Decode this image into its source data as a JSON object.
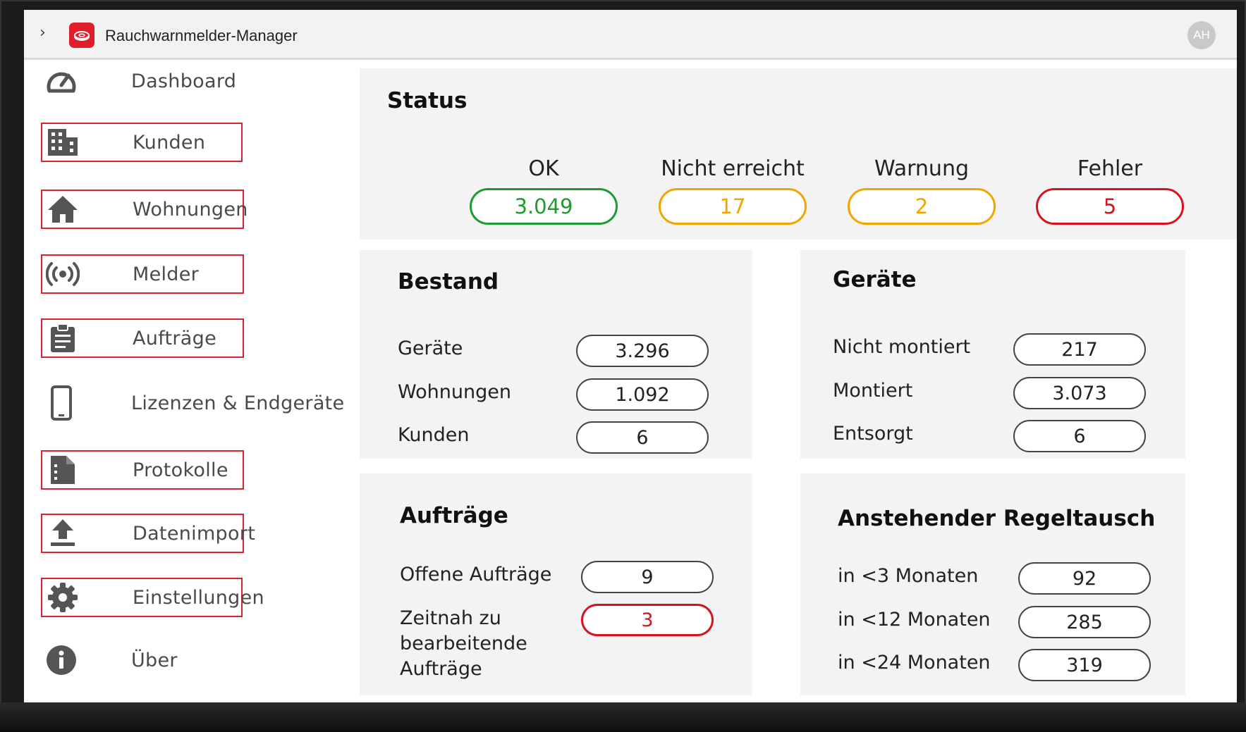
{
  "app": {
    "title": "Rauchwarnmelder-Manager",
    "avatar_initials": "AH",
    "accent_color": "#e01e2b"
  },
  "sidebar": {
    "items": [
      {
        "label": "Dashboard",
        "icon": "speedometer-icon"
      },
      {
        "label": "Kunden",
        "icon": "building-icon"
      },
      {
        "label": "Wohnungen",
        "icon": "home-icon"
      },
      {
        "label": "Melder",
        "icon": "broadcast-icon"
      },
      {
        "label": "Aufträge",
        "icon": "clipboard-icon"
      },
      {
        "label": "Lizenzen & Endgeräte",
        "icon": "smartphone-icon"
      },
      {
        "label": "Protokolle",
        "icon": "document-icon"
      },
      {
        "label": "Datenimport",
        "icon": "upload-icon"
      },
      {
        "label": "Einstellungen",
        "icon": "gear-icon"
      },
      {
        "label": "Über",
        "icon": "info-icon"
      }
    ]
  },
  "status": {
    "title": "Status",
    "items": [
      {
        "label": "OK",
        "value": "3.049",
        "color": "#1f9a2e"
      },
      {
        "label": "Nicht erreicht",
        "value": "17",
        "color": "#f0a500"
      },
      {
        "label": "Warnung",
        "value": "2",
        "color": "#f0a500"
      },
      {
        "label": "Fehler",
        "value": "5",
        "color": "#d8111f"
      }
    ]
  },
  "bestand": {
    "title": "Bestand",
    "rows": [
      {
        "label": "Geräte",
        "value": "3.296"
      },
      {
        "label": "Wohnungen",
        "value": "1.092"
      },
      {
        "label": "Kunden",
        "value": "6"
      }
    ]
  },
  "geraete": {
    "title": "Geräte",
    "rows": [
      {
        "label": "Nicht montiert",
        "value": "217"
      },
      {
        "label": "Montiert",
        "value": "3.073"
      },
      {
        "label": "Entsorgt",
        "value": "6"
      }
    ]
  },
  "auftraege": {
    "title": "Aufträge",
    "rows": [
      {
        "label": "Offene Aufträge",
        "value": "9"
      },
      {
        "label": "Zeitnah zu bearbeitende Aufträge",
        "label_lines": [
          "Zeitnah zu",
          "bearbeitende",
          "Aufträge"
        ],
        "value": "3",
        "color": "#d8111f"
      }
    ]
  },
  "regeltausch": {
    "title": "Anstehender Regeltausch",
    "rows": [
      {
        "label": "in <3 Monaten",
        "value": "92"
      },
      {
        "label": "in <12 Monaten",
        "value": "285"
      },
      {
        "label": "in <24 Monaten",
        "value": "319"
      }
    ]
  }
}
